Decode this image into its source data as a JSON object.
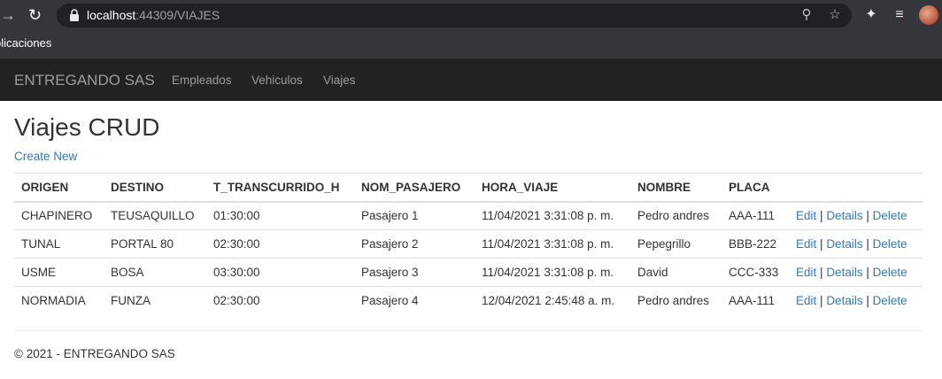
{
  "browser": {
    "url_host": "localhost",
    "url_path": ":44309/VIAJES",
    "bookmark_label": "plicaciones",
    "icons": [
      "forward-icon",
      "reload-icon",
      "lock-icon",
      "zoom-icon",
      "star-icon",
      "extensions-icon",
      "media-icon",
      "profile-avatar"
    ]
  },
  "navbar": {
    "brand": "ENTREGANDO SAS",
    "links": [
      "Empleados",
      "Vehiculos",
      "Viajes"
    ]
  },
  "page": {
    "title": "Viajes CRUD",
    "create_new": "Create New"
  },
  "table": {
    "headers": [
      "ORIGEN",
      "DESTINO",
      "T_TRANSCURRIDO_H",
      "NOM_PASAJERO",
      "HORA_VIAJE",
      "NOMBRE",
      "PLACA"
    ],
    "rows": [
      [
        "CHAPINERO",
        "TEUSAQUILLO",
        "01:30:00",
        "Pasajero 1",
        "11/04/2021 3:31:08 p. m.",
        "Pedro andres",
        "AAA-111"
      ],
      [
        "TUNAL",
        "PORTAL 80",
        "02:30:00",
        "Pasajero 2",
        "11/04/2021 3:31:08 p. m.",
        "Pepegrillo",
        "BBB-222"
      ],
      [
        "USME",
        "BOSA",
        "03:30:00",
        "Pasajero 3",
        "11/04/2021 3:31:08 p. m.",
        "David",
        "CCC-333"
      ],
      [
        "NORMADIA",
        "FUNZA",
        "02:30:00",
        "Pasajero 4",
        "12/04/2021 2:45:48 a. m.",
        "Pedro andres",
        "AAA-111"
      ]
    ],
    "actions": {
      "edit": "Edit",
      "details": "Details",
      "delete": "Delete",
      "separator": "|"
    }
  },
  "footer": {
    "text": "© 2021 - ENTREGANDO SAS"
  },
  "colors": {
    "navbar_bg": "#222222",
    "link": "#337ab7",
    "chrome_bg": "#35363a"
  }
}
